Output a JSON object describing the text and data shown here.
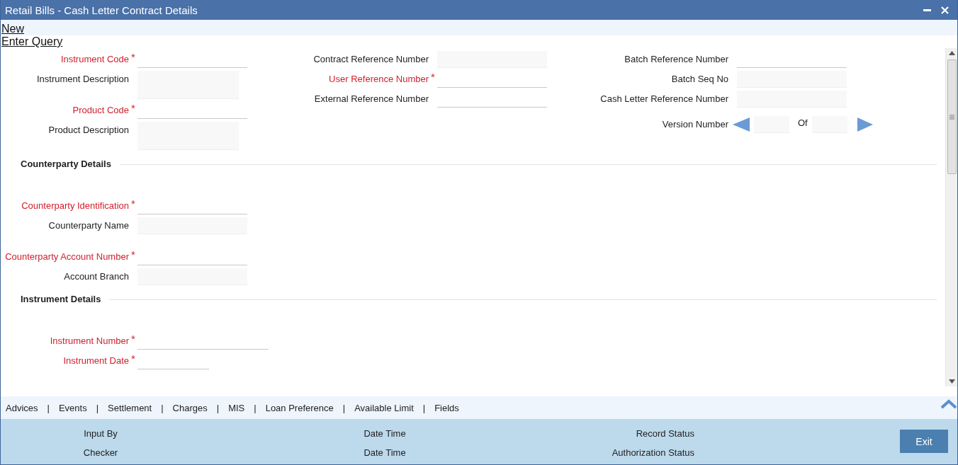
{
  "window": {
    "title": "Retail Bills - Cash Letter Contract Details"
  },
  "menu": [
    {
      "label": "New"
    },
    {
      "label": "Enter Query"
    }
  ],
  "header": {
    "columns": [
      [
        {
          "label": "Instrument Code",
          "required": true,
          "mark": "*",
          "kind": "input"
        },
        {
          "label": "Instrument Description",
          "required": false,
          "kind": "memo"
        },
        {
          "label": "Product Code",
          "required": true,
          "mark": "*",
          "kind": "input"
        },
        {
          "label": "Product Description",
          "required": false,
          "kind": "memo"
        }
      ],
      [
        {
          "label": "Contract Reference Number",
          "required": false,
          "kind": "display"
        },
        {
          "label": "User Reference Number",
          "required": true,
          "mark": "*",
          "kind": "input"
        },
        {
          "label": "External Reference Number",
          "required": false,
          "kind": "input"
        }
      ],
      [
        {
          "label": "Batch Reference Number",
          "required": false,
          "kind": "input"
        },
        {
          "label": "Batch Seq No",
          "required": false,
          "kind": "display"
        },
        {
          "label": "Cash Letter Reference Number",
          "required": false,
          "kind": "display"
        }
      ]
    ],
    "version": {
      "label": "Version Number",
      "of": "Of"
    }
  },
  "sections": [
    {
      "title": "Counterparty Details",
      "groups": [
        [
          {
            "label": "Counterparty Identification",
            "required": true,
            "mark": "*",
            "kind": "input"
          },
          {
            "label": "Counterparty Name",
            "required": false,
            "kind": "display"
          }
        ],
        [
          {
            "label": "Counterparty Account Number",
            "required": true,
            "mark": "*",
            "kind": "input"
          },
          {
            "label": "Account Branch",
            "required": false,
            "kind": "display"
          }
        ]
      ]
    },
    {
      "title": "Instrument Details",
      "groups": [
        [
          {
            "label": "Instrument Number",
            "required": true,
            "mark": "*",
            "kind": "wide"
          },
          {
            "label": "Instrument Date",
            "required": true,
            "mark": "*",
            "kind": "short"
          }
        ]
      ]
    }
  ],
  "tab_bar": {
    "separator": "|",
    "tabs": [
      {
        "label": "Advices"
      },
      {
        "label": "Events"
      },
      {
        "label": "Settlement"
      },
      {
        "label": "Charges"
      },
      {
        "label": "MIS"
      },
      {
        "label": "Loan Preference"
      },
      {
        "label": "Available Limit"
      },
      {
        "label": "Fields"
      }
    ]
  },
  "audit": [
    {
      "label": "Input By"
    },
    {
      "label": "Date Time"
    },
    {
      "label": "Record Status"
    },
    {
      "label": "Checker"
    },
    {
      "label": "Date Time"
    },
    {
      "label": "Authorization Status"
    }
  ],
  "exit_button": "Exit"
}
